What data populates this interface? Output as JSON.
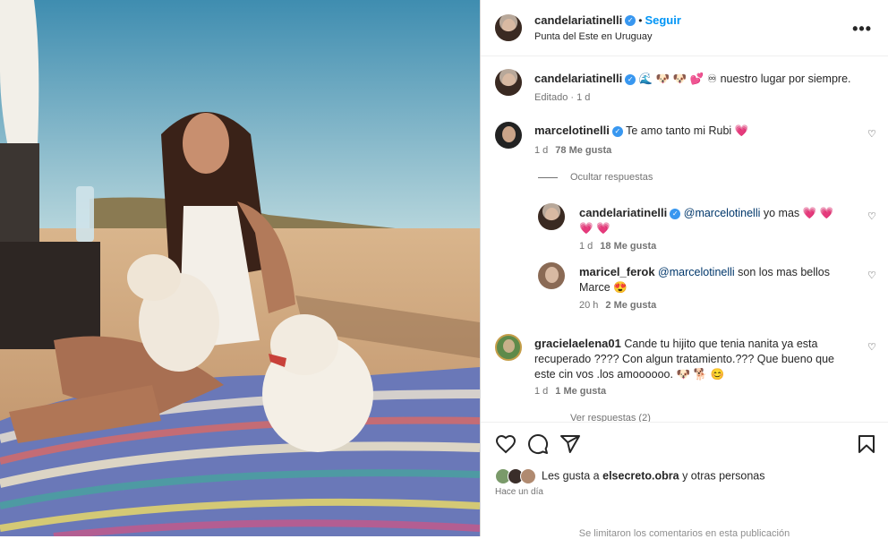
{
  "post": {
    "author": "candelariatinelli",
    "follow_label": "Seguir",
    "separator": "•",
    "location": "Punta del Este en Uruguay",
    "more_icon": "more-horizontal-icon",
    "verified_icon": "verified-badge-icon"
  },
  "caption": {
    "username": "candelariatinelli",
    "emojis": "🌊 🐶 🐶 💕 ♾",
    "text": "nuestro lugar por siempre.",
    "meta": "Editado · 1 d"
  },
  "comments": [
    {
      "username": "marcelotinelli",
      "text": "Te amo tanto mi Rubi",
      "emoji": "💗",
      "time": "1 d",
      "likes": "78 Me gusta"
    },
    {
      "username": "gracielaelena01",
      "text": "Cande tu hijito que tenia nanita ya esta recuperado ???? Con algun tratamiento.??? Que bueno que este cin vos .los amoooooo.",
      "emoji": "🐶 🐕 😊",
      "time": "1 d",
      "likes": "1 Me gusta"
    }
  ],
  "hide_replies_label": "Ocultar respuestas",
  "replies": [
    {
      "username": "candelariatinelli",
      "mention": "@marcelotinelli",
      "text": "yo mas",
      "emoji": "💗 💗 💗 💗",
      "time": "1 d",
      "likes": "18 Me gusta"
    },
    {
      "username": "maricel_ferok",
      "mention": "@marcelotinelli",
      "text": "son los mas bellos Marce",
      "emoji": "😍",
      "time": "20 h",
      "likes": "2 Me gusta"
    }
  ],
  "view_replies_label": "Ver respuestas (2)",
  "actions": {
    "like_icon": "heart-icon",
    "comment_icon": "comment-icon",
    "share_icon": "share-icon",
    "save_icon": "bookmark-icon"
  },
  "likes_line": {
    "prefix": "Les gusta a",
    "user": "elsecreto.obra",
    "suffix": "y otras personas"
  },
  "time_ago": "Hace un día",
  "comments_limited": "Se limitaron los comentarios en esta publicación",
  "colors": {
    "link_blue": "#0095f6",
    "verified": "#3897f0",
    "heart_pink": "#e0245e"
  }
}
